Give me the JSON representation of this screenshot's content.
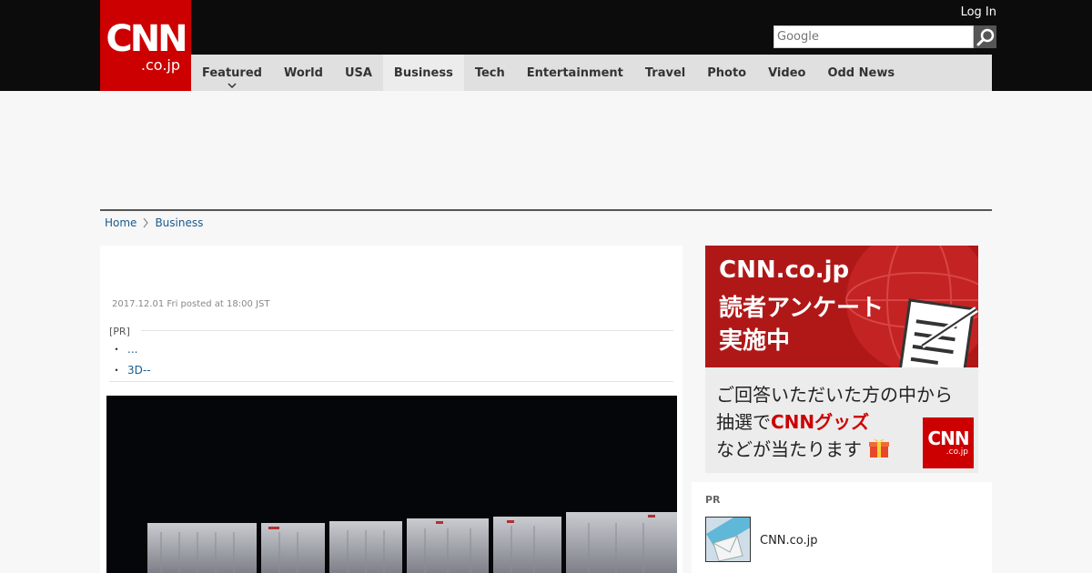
{
  "header": {
    "logo_main": "CNN",
    "logo_sub": ".co.jp",
    "login_label": "Log In",
    "search_placeholder": "Google"
  },
  "nav": {
    "items": [
      {
        "label": "Featured"
      },
      {
        "label": "World"
      },
      {
        "label": "USA"
      },
      {
        "label": "Business"
      },
      {
        "label": "Tech"
      },
      {
        "label": "Entertainment"
      },
      {
        "label": "Travel"
      },
      {
        "label": "Photo"
      },
      {
        "label": "Video"
      },
      {
        "label": "Odd News"
      }
    ],
    "active": "Business"
  },
  "breadcrumb": {
    "home": "Home",
    "current": "Business"
  },
  "article": {
    "date": "2017.12.01 Fri posted at 18:00 JST",
    "pr_label": "[PR]",
    "pr_items": [
      {
        "text": "..."
      },
      {
        "text": "3D--"
      }
    ],
    "bullet": "・"
  },
  "banner": {
    "line1": "CNN.co.jp",
    "line2": "読者アンケート",
    "line3": "実施中",
    "sub1": "ご回答いただいた方の中から",
    "sub2_pre": "抽選で",
    "sub2_red": "CNNグッズ",
    "sub3": "などが当たります",
    "logo_main": "CNN",
    "logo_sub": ".co.jp"
  },
  "pr_box": {
    "heading": "PR",
    "item_label": "CNN.co.jp"
  },
  "colors": {
    "brand_red": "#cc0000",
    "header_black": "#0c0c0c",
    "link_blue": "#1a5b8c"
  }
}
